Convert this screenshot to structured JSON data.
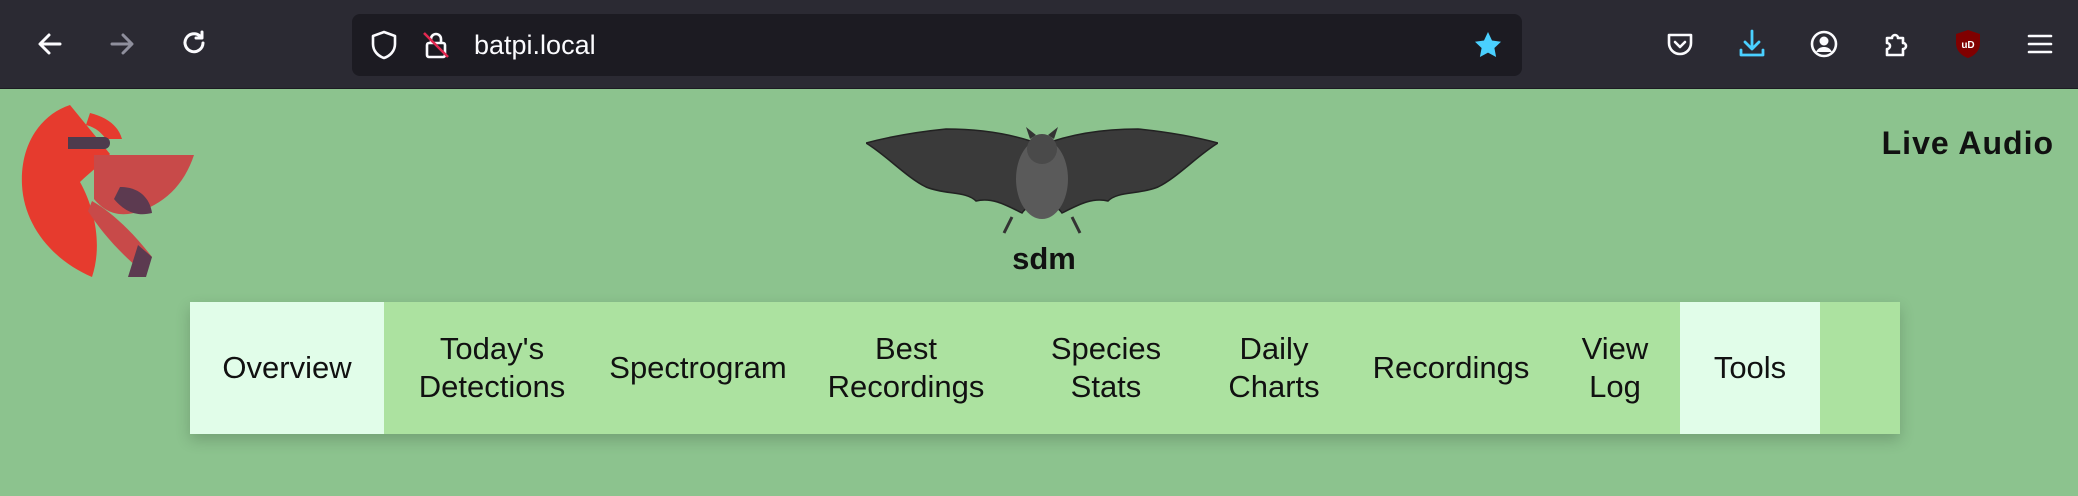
{
  "browser": {
    "url": "batpi.local",
    "icons": {
      "back": "arrow-left-icon",
      "forward": "arrow-right-icon",
      "reload": "reload-icon",
      "shield": "tracking-shield-icon",
      "lock": "insecure-lock-icon",
      "bookmark": "star-icon",
      "pocket": "pocket-icon",
      "downloads": "download-icon",
      "account": "account-icon",
      "extensions": "puzzle-icon",
      "ublock": "ublock-shield-icon",
      "menu": "hamburger-menu-icon"
    },
    "ublock_label": "uD"
  },
  "site": {
    "title": "sdm",
    "live_audio": "Live Audio"
  },
  "nav": {
    "items": [
      {
        "label": "Overview",
        "active": true
      },
      {
        "label": "Today's Detections"
      },
      {
        "label": "Spectrogram"
      },
      {
        "label": "Best Recordings"
      },
      {
        "label": "Species Stats"
      },
      {
        "label": "Daily Charts"
      },
      {
        "label": "Recordings"
      },
      {
        "label": "View Log"
      },
      {
        "label": "Tools",
        "active": true
      }
    ]
  },
  "colors": {
    "page_bg": "#8cc38e",
    "nav_bg": "#ace2a0",
    "nav_active_bg": "#e1fde9",
    "toolbar_bg": "#2b2a33",
    "urlbar_bg": "#1c1b22",
    "bookmark_star": "#54ffbd"
  }
}
